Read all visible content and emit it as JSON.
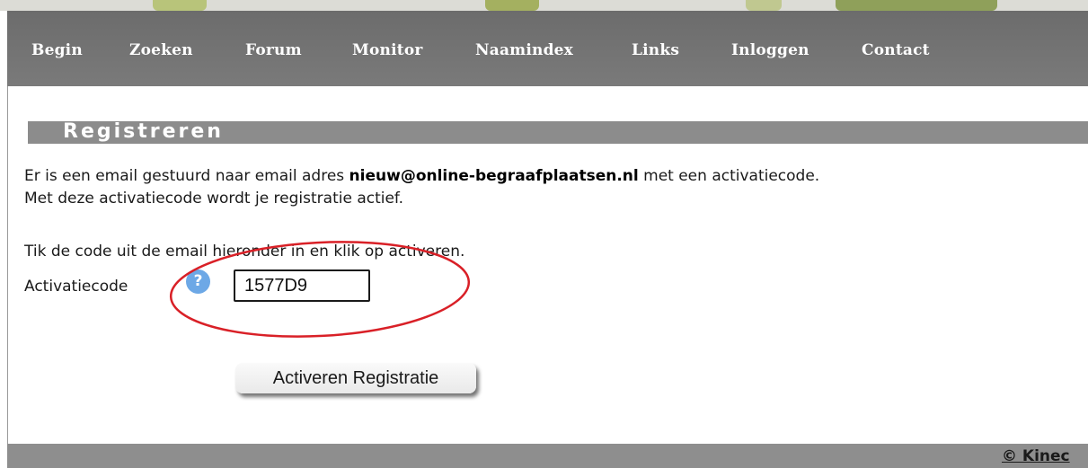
{
  "nav": {
    "items": [
      {
        "label": "Begin"
      },
      {
        "label": "Zoeken"
      },
      {
        "label": "Forum"
      },
      {
        "label": "Monitor"
      },
      {
        "label": "Naamindex"
      },
      {
        "label": "Links"
      },
      {
        "label": "Inloggen"
      },
      {
        "label": "Contact"
      }
    ]
  },
  "section": {
    "title": "Registreren"
  },
  "message": {
    "line1_prefix": "Er is een email gestuurd naar email adres ",
    "email": "nieuw@online-begraafplaatsen.nl",
    "line1_suffix": " met een activatiecode.",
    "line2": "Met deze activatiecode wordt je registratie actief.",
    "instruction": "Tik de code uit de email hieronder in en klik op activeren."
  },
  "form": {
    "label": "Activatiecode",
    "help_icon": "question-icon",
    "code_value": "1577D9",
    "submit_label": "Activeren Registratie"
  },
  "annotation_color": "#d92027",
  "footer": {
    "copyright": "© Kinec"
  }
}
